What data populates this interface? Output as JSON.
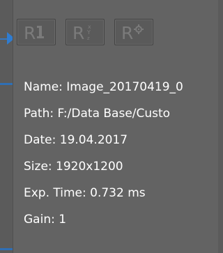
{
  "toolbar": {
    "buttons": [
      {
        "glyph": "R",
        "icon": "reset-icon"
      },
      {
        "glyph": "R",
        "icon": "reset-axes-icon"
      },
      {
        "glyph": "R",
        "icon": "reset-settings-icon"
      }
    ]
  },
  "info": {
    "name": "Name: Image_20170419_0",
    "path": "Path: F:/Data Base/Custo",
    "date": "Date: 19.04.2017",
    "size": "Size: 1920x1200",
    "exp_time": "Exp. Time: 0.732 ms",
    "gain": "Gain: 1"
  },
  "colors": {
    "panel_bg": "#636363",
    "text": "#ffffff",
    "accent": "#2f7cd0",
    "button_glyph": "#7b7b7b"
  }
}
